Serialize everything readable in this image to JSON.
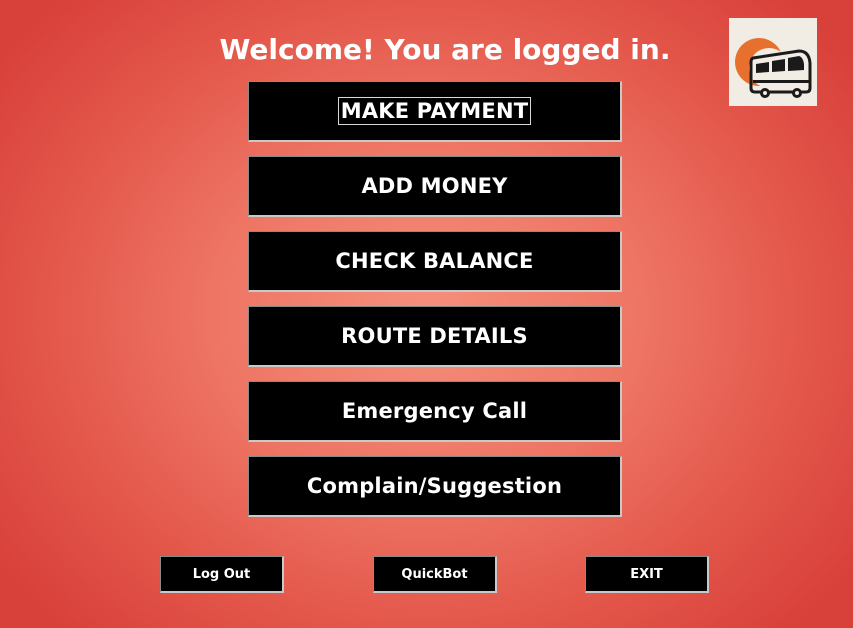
{
  "header": {
    "title": "Welcome! You are logged in."
  },
  "logo": {
    "icon": "bus-logo-icon",
    "colors": {
      "background": "#f1ece4",
      "accent": "#e8702e",
      "ink": "#1a1a1a"
    }
  },
  "menu": {
    "items": [
      {
        "label": "MAKE PAYMENT"
      },
      {
        "label": "ADD MONEY"
      },
      {
        "label": "CHECK BALANCE"
      },
      {
        "label": "ROUTE DETAILS"
      },
      {
        "label": "Emergency Call"
      },
      {
        "label": "Complain/Suggestion"
      }
    ]
  },
  "footer": {
    "logout_label": "Log Out",
    "quickbot_label": "QuickBot",
    "exit_label": "EXIT"
  },
  "theme": {
    "background_center": "#f4907c",
    "background_edge": "#d8403a",
    "button_bg": "#000000",
    "button_text": "#ffffff"
  }
}
